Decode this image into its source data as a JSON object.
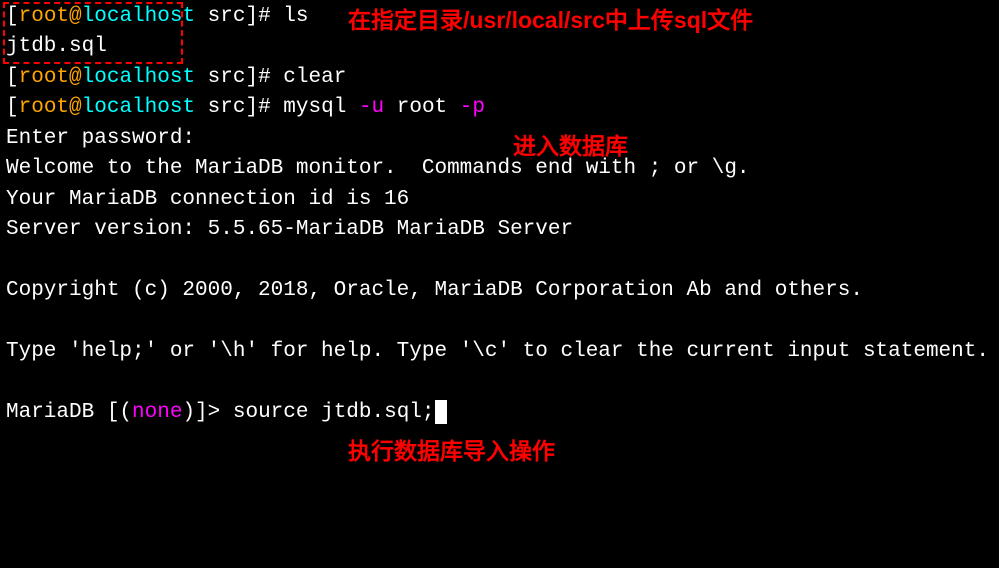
{
  "lines": {
    "l1_bracket_open": "[",
    "l1_user": "root",
    "l1_at": "@",
    "l1_host": "localhost",
    "l1_dir": " src",
    "l1_bracket_close": "]# ",
    "l1_cmd": "ls",
    "l2_file": "jtdb.sql",
    "l3_bracket_open": "[",
    "l3_user": "root",
    "l3_at": "@",
    "l3_host": "localhost",
    "l3_dir": " src",
    "l3_bracket_close": "]# ",
    "l3_cmd": "clear",
    "l4_bracket_open": "[",
    "l4_user": "root",
    "l4_at": "@",
    "l4_host": "localhost",
    "l4_dir": " src",
    "l4_bracket_close": "]# ",
    "l4_cmd_pre": "mysql ",
    "l4_flag1": "-u",
    "l4_cmd_mid": " root ",
    "l4_flag2": "-p",
    "l5": "Enter password:",
    "l6": "Welcome to the MariaDB monitor.  Commands end with ; or \\g.",
    "l7": "Your MariaDB connection id is 16",
    "l8": "Server version: 5.5.65-MariaDB MariaDB Server",
    "l9": "",
    "l10": "Copyright (c) 2000, 2018, Oracle, MariaDB Corporation Ab and others.",
    "l11": "",
    "l12": "Type 'help;' or '\\h' for help. Type '\\c' to clear the current input statement.",
    "l13": "",
    "l14_pre": "MariaDB [(",
    "l14_none": "none",
    "l14_post": ")]> ",
    "l14_cmd": "source jtdb.sql;"
  },
  "annotations": {
    "a1": "在指定目录/usr/local/src中上传sql文件",
    "a2": "进入数据库",
    "a3": "执行数据库导入操作"
  }
}
